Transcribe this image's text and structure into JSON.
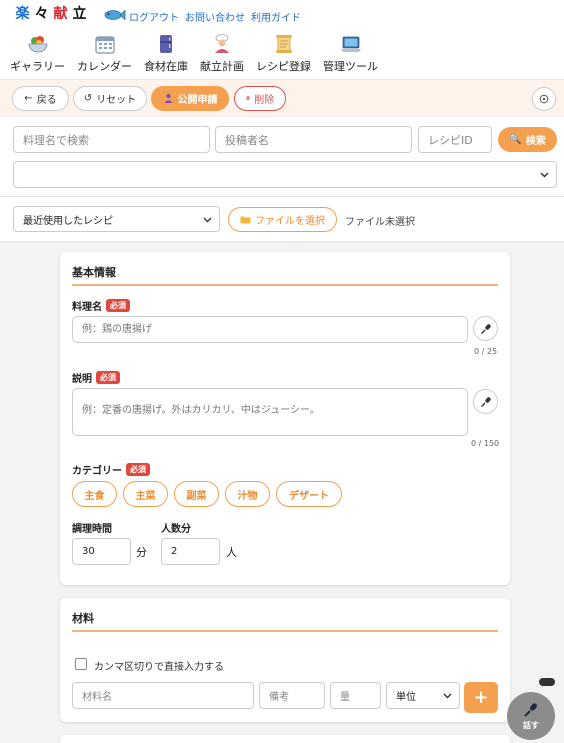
{
  "header": {
    "logo_chars": [
      "楽",
      "々",
      "献",
      "立"
    ],
    "links": [
      "ログアウト",
      "お問い合わせ",
      "利用ガイド"
    ],
    "nav": [
      {
        "label": "ギャラリー",
        "icon": "salad-bowl-icon"
      },
      {
        "label": "カレンダー",
        "icon": "calendar-icon"
      },
      {
        "label": "食材在庫",
        "icon": "fridge-icon"
      },
      {
        "label": "献立計画",
        "icon": "chef-icon"
      },
      {
        "label": "レシピ登録",
        "icon": "scroll-icon"
      },
      {
        "label": "管理ツール",
        "icon": "laptop-icon"
      }
    ]
  },
  "actionbar": {
    "back": "戻る",
    "reset": "リセット",
    "publish": "公開申請",
    "delete": "削除"
  },
  "search": {
    "name_placeholder": "料理名で検索",
    "poster_placeholder": "投稿者名",
    "id_placeholder": "レシピID",
    "button": "検索",
    "select_value": ""
  },
  "filebar": {
    "recent_selected": "最近使用したレシピ",
    "file_button": "ファイルを選択",
    "file_status": "ファイル未選択"
  },
  "basic": {
    "title": "基本情報",
    "required_badge": "必須",
    "name_label": "料理名",
    "name_placeholder": "例：鶏の唐揚げ",
    "name_count": "0 / 25",
    "desc_label": "説明",
    "desc_placeholder": "例：定番の唐揚げ。外はカリカリ、中はジューシー。",
    "desc_count": "0 / 150",
    "category_label": "カテゴリー",
    "categories": [
      "主食",
      "主菜",
      "副菜",
      "汁物",
      "デザート"
    ],
    "time_label": "調理時間",
    "time_value": "30",
    "time_unit": "分",
    "servings_label": "人数分",
    "servings_value": "2",
    "servings_unit": "人"
  },
  "ingredients": {
    "title": "材料",
    "csv_label": "カンマ区切りで直接入力する",
    "name_placeholder": "材料名",
    "note_placeholder": "備考",
    "qty_placeholder": "量",
    "unit_selected": "単位",
    "add_button": "+"
  },
  "talk_button": "話す",
  "colors": {
    "accent": "#f5a04e",
    "danger": "#e0483d",
    "link": "#1f6fd0"
  }
}
